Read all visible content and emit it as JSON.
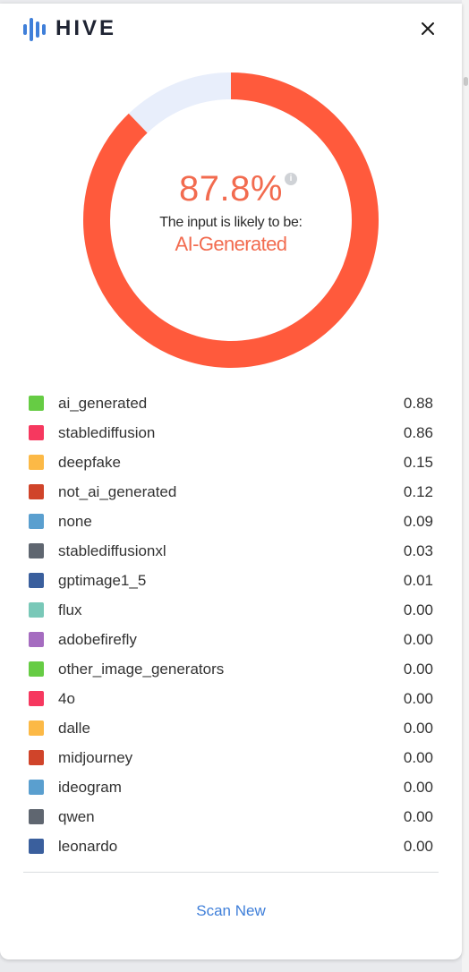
{
  "header": {
    "logo_text": "HIVE",
    "logo_icon": "hive-bars-icon",
    "close_icon": "close-icon"
  },
  "result": {
    "percent": "87.8%",
    "percent_value": 0.878,
    "likely_text": "The input is likely to be:",
    "verdict": "AI-Generated",
    "info_icon": "i",
    "colors": {
      "primary": "#ff5a3c",
      "remainder": "#e8eefb",
      "accent_text": "#f26b4f"
    }
  },
  "scores": [
    {
      "label": "ai_generated",
      "value": "0.88",
      "color": "#66cc44"
    },
    {
      "label": "stablediffusion",
      "value": "0.86",
      "color": "#f6385f"
    },
    {
      "label": "deepfake",
      "value": "0.15",
      "color": "#fcb946"
    },
    {
      "label": "not_ai_generated",
      "value": "0.12",
      "color": "#d0442a"
    },
    {
      "label": "none",
      "value": "0.09",
      "color": "#5a9fcf"
    },
    {
      "label": "stablediffusionxl",
      "value": "0.03",
      "color": "#5f6670"
    },
    {
      "label": "gptimage1_5",
      "value": "0.01",
      "color": "#3a5f9d"
    },
    {
      "label": "flux",
      "value": "0.00",
      "color": "#79c8b8"
    },
    {
      "label": "adobefirefly",
      "value": "0.00",
      "color": "#a56cc0"
    },
    {
      "label": "other_image_generators",
      "value": "0.00",
      "color": "#66cc44"
    },
    {
      "label": "4o",
      "value": "0.00",
      "color": "#f6385f"
    },
    {
      "label": "dalle",
      "value": "0.00",
      "color": "#fcb946"
    },
    {
      "label": "midjourney",
      "value": "0.00",
      "color": "#d0442a"
    },
    {
      "label": "ideogram",
      "value": "0.00",
      "color": "#5a9fcf"
    },
    {
      "label": "qwen",
      "value": "0.00",
      "color": "#5f6670"
    },
    {
      "label": "leonardo",
      "value": "0.00",
      "color": "#3a5f9d"
    }
  ],
  "footer": {
    "scan_new_label": "Scan New",
    "link_color": "#3f7fd9"
  }
}
